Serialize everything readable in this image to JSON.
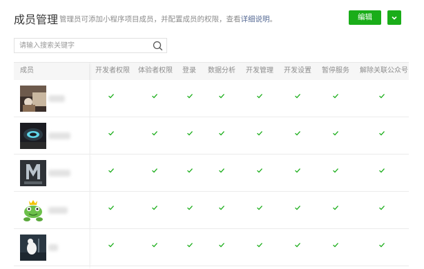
{
  "header": {
    "title": "成员管理",
    "desc_prefix": "管理员可添加小程序项目成员，并配置成员的权限，查看",
    "desc_link": "详细说明",
    "desc_suffix": "。",
    "edit_label": "编辑"
  },
  "search": {
    "placeholder": "请输入搜索关键字"
  },
  "table": {
    "columns": [
      "成员",
      "开发者权限",
      "体验者权限",
      "登录",
      "数据分析",
      "开发管理",
      "开发设置",
      "暂停服务",
      "解除关联公众号"
    ],
    "rows": [
      {
        "name": "",
        "permissions": [
          true,
          true,
          true,
          true,
          true,
          true,
          true,
          true
        ]
      },
      {
        "name": "",
        "permissions": [
          true,
          true,
          true,
          true,
          true,
          true,
          true,
          true
        ]
      },
      {
        "name": "",
        "permissions": [
          true,
          true,
          true,
          true,
          true,
          true,
          true,
          true
        ]
      },
      {
        "name": "",
        "permissions": [
          true,
          true,
          true,
          true,
          true,
          true,
          true,
          true
        ]
      },
      {
        "name": "",
        "permissions": [
          true,
          true,
          true,
          true,
          true,
          true,
          true,
          true
        ]
      }
    ]
  },
  "colors": {
    "accent": "#1aad19",
    "link": "#576b95",
    "muted": "#8d8d8d"
  },
  "icons": {
    "search": "search-icon",
    "dropdown": "chevron-down-icon",
    "check": "check-icon"
  }
}
